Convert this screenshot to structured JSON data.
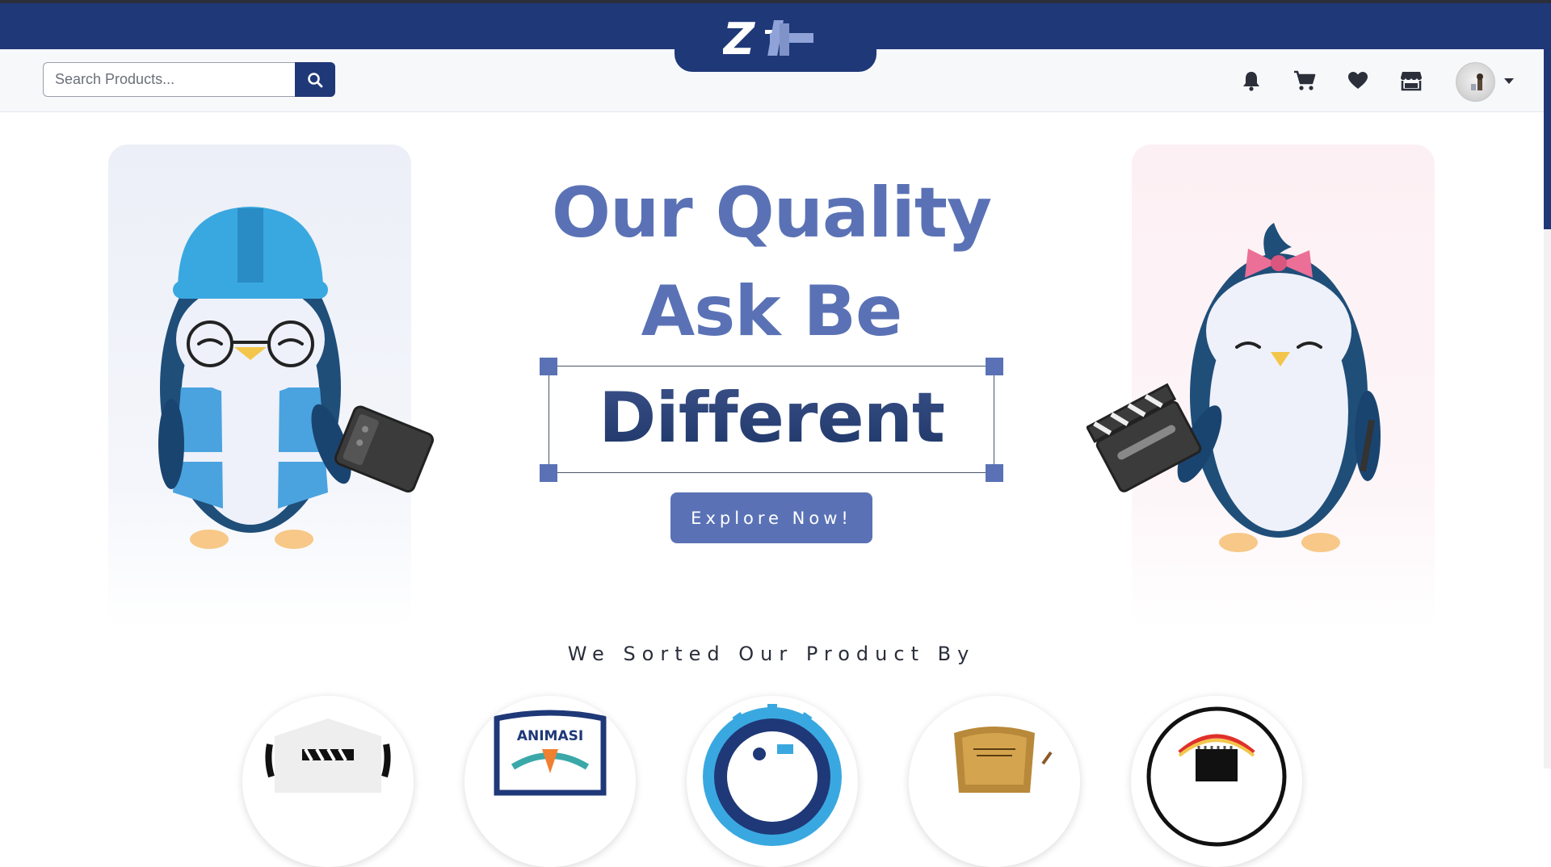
{
  "header": {
    "logo_text": "Z+",
    "search": {
      "placeholder": "Search Products...",
      "value": ""
    },
    "icons": [
      "bell-icon",
      "cart-icon",
      "heart-icon",
      "store-icon"
    ]
  },
  "hero": {
    "line1": "Our Quality",
    "line2": "Ask Be",
    "line3": "Different",
    "cta_label": "Explore Now!"
  },
  "categories": {
    "title": "We Sorted Our Product By",
    "items": [
      {
        "icon": "film-clapper-badge",
        "label": ""
      },
      {
        "icon": "animasi-badge",
        "label": "ANIMASI"
      },
      {
        "icon": "software-gear-badge",
        "label": ""
      },
      {
        "icon": "network-badge",
        "label": ""
      },
      {
        "icon": "electronics-badge",
        "label": ""
      }
    ]
  },
  "colors": {
    "navy": "#1f3878",
    "accent": "#5a72b5",
    "card_left": "#eceff7",
    "card_right": "#fdf0f4"
  }
}
